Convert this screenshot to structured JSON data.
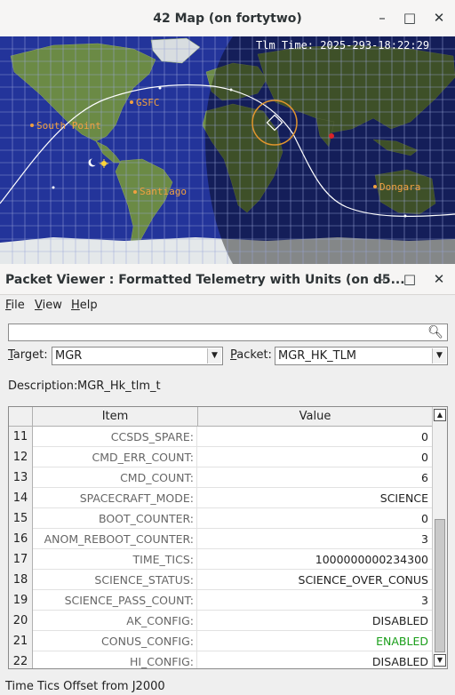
{
  "map_window": {
    "title": "42 Map (on fortytwo)",
    "tlm_time": "Tlm Time:  2025-293-18:22:29",
    "sites": [
      "GSFC",
      "South Point",
      "Santiago",
      "Dongara"
    ],
    "controls": {
      "minimize": "–",
      "maximize": "□",
      "close": "✕"
    }
  },
  "packet_viewer": {
    "title": "Packet Viewer : Formatted Telemetry with Units (on d5...",
    "controls": {
      "minimize": "–",
      "maximize": "□",
      "close": "✕"
    },
    "menu": [
      {
        "underline": "F",
        "rest": "ile"
      },
      {
        "underline": "V",
        "rest": "iew"
      },
      {
        "underline": "H",
        "rest": "elp"
      }
    ],
    "search": {
      "value": "",
      "placeholder": ""
    },
    "target_label_u": "T",
    "target_label_rest": "arget:",
    "target_value": "MGR",
    "packet_label_u": "P",
    "packet_label_rest": "acket:",
    "packet_value": "MGR_HK_TLM",
    "description_label": "Description:",
    "description_value": "MGR_Hk_tlm_t",
    "columns": [
      "Item",
      "Value"
    ],
    "rows": [
      {
        "n": "11",
        "item": "CCSDS_SPARE:",
        "value": "0"
      },
      {
        "n": "12",
        "item": "CMD_ERR_COUNT:",
        "value": "0"
      },
      {
        "n": "13",
        "item": "CMD_COUNT:",
        "value": "6"
      },
      {
        "n": "14",
        "item": "SPACECRAFT_MODE:",
        "value": "SCIENCE"
      },
      {
        "n": "15",
        "item": "BOOT_COUNTER:",
        "value": "0"
      },
      {
        "n": "16",
        "item": "ANOM_REBOOT_COUNTER:",
        "value": "3"
      },
      {
        "n": "17",
        "item": "TIME_TICS:",
        "value": "1000000000234300"
      },
      {
        "n": "18",
        "item": "SCIENCE_STATUS:",
        "value": "SCIENCE_OVER_CONUS"
      },
      {
        "n": "19",
        "item": "SCIENCE_PASS_COUNT:",
        "value": "3"
      },
      {
        "n": "20",
        "item": "AK_CONFIG:",
        "value": "DISABLED"
      },
      {
        "n": "21",
        "item": "CONUS_CONFIG:",
        "value": "ENABLED"
      },
      {
        "n": "22",
        "item": "HI_CONFIG:",
        "value": "DISABLED"
      }
    ],
    "status": "Time Tics Offset from J2000",
    "colors": {
      "enabled": "#1a9e1a",
      "ocean": "#23349a",
      "orbit": "#ffffff",
      "site": "#f0a040"
    }
  }
}
